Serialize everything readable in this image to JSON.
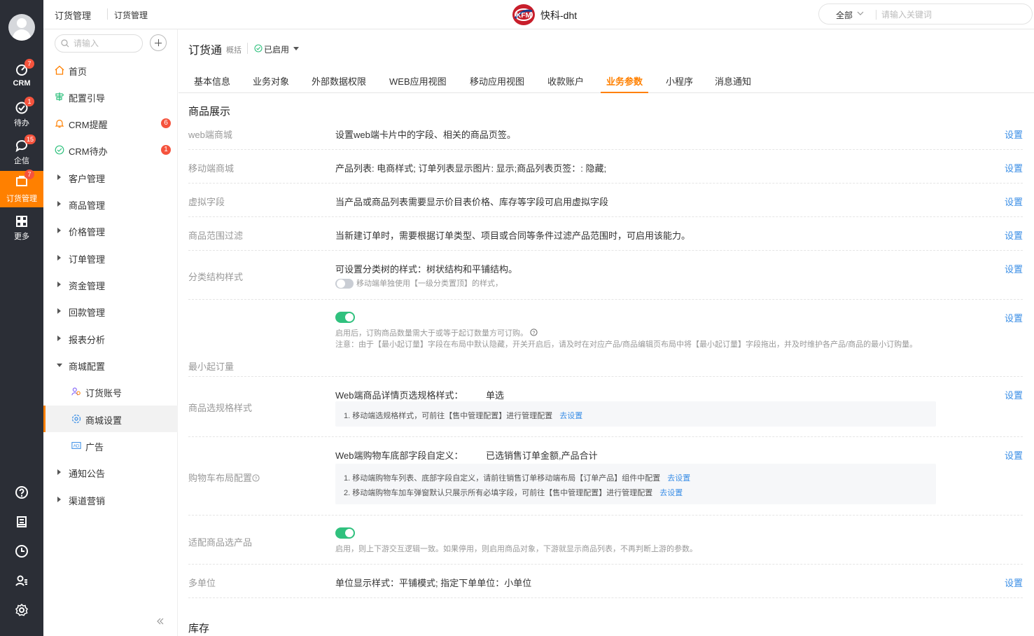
{
  "rail": {
    "items": [
      {
        "label": "CRM",
        "badge": "7",
        "icon": "crm-icon"
      },
      {
        "label": "待办",
        "badge": "1",
        "icon": "todo-check-icon"
      },
      {
        "label": "企信",
        "badge": "15",
        "icon": "chat-bubble-icon"
      },
      {
        "label": "订货管理",
        "badge": "7",
        "icon": "order-bag-icon"
      },
      {
        "label": "更多",
        "badge": "",
        "icon": "grid-icon"
      }
    ]
  },
  "topbar": {
    "crumb1": "订货管理",
    "crumb2": "订货管理",
    "brand": "快科-dht",
    "search_scope": "全部",
    "search_placeholder": "请输入关键词"
  },
  "sidebar": {
    "search_placeholder": "请输入",
    "items": [
      {
        "label": "首页",
        "badge": ""
      },
      {
        "label": "配置引导",
        "badge": ""
      },
      {
        "label": "CRM提醒",
        "badge": "6"
      },
      {
        "label": "CRM待办",
        "badge": "1"
      },
      {
        "label": "客户管理"
      },
      {
        "label": "商品管理"
      },
      {
        "label": "价格管理"
      },
      {
        "label": "订单管理"
      },
      {
        "label": "资金管理"
      },
      {
        "label": "回款管理"
      },
      {
        "label": "报表分析"
      },
      {
        "label": "商城配置"
      },
      {
        "label": "订货账号"
      },
      {
        "label": "商城设置"
      },
      {
        "label": "广告"
      },
      {
        "label": "通知公告"
      },
      {
        "label": "渠道营销"
      }
    ]
  },
  "main": {
    "title": "订货通",
    "subtitle": "概括",
    "status": "已启用",
    "tabs": [
      "基本信息",
      "业务对象",
      "外部数据权限",
      "WEB应用视图",
      "移动应用视图",
      "收款账户",
      "业务参数",
      "小程序",
      "消息通知"
    ],
    "active_tab": "业务参数",
    "section1": "商品展示",
    "section2": "库存",
    "set_label": "设置",
    "rows": {
      "web_mall": {
        "label": "web端商城",
        "content": "设置web端卡片中的字段、相关的商品页签。"
      },
      "mobile_mall": {
        "label": "移动端商城",
        "content": "产品列表: 电商样式; 订单列表显示图片: 显示;商品列表页签：: 隐藏;"
      },
      "virtual_field": {
        "label": "虚拟字段",
        "content": "当产品或商品列表需要显示价目表价格、库存等字段可启用虚拟字段"
      },
      "range_filter": {
        "label": "商品范围过滤",
        "content": "当新建订单时，需要根据订单类型、项目或合同等条件过滤产品范围时，可启用该能力。"
      },
      "category_style": {
        "label": "分类结构样式",
        "content": "可设置分类树的样式：树状结构和平铺结构。",
        "toggle_note": "移动端单独使用【一级分类置顶】的样式，"
      },
      "min_order": {
        "label": "最小起订量",
        "note1": "启用后，订购商品数量需大于或等于起订数量方可订购。",
        "note2": "注意：由于【最小起订量】字段在布局中默认隐藏，开关开启后，请及时在对应产品/商品编辑页布局中将【最小起订量】字段拖出，并及时维护各产品/商品的最小订购量。"
      },
      "spec_style": {
        "label": "商品选规格样式",
        "key": "Web端商品详情页选规格样式：",
        "value": "单选",
        "box1": "1. 移动端选规格样式，可前往【售中管理配置】进行管理配置",
        "link": "去设置"
      },
      "cart_layout": {
        "label": "购物车布局配置",
        "key": "Web端购物车底部字段自定义：",
        "value": "已选销售订单金额,产品合计",
        "box1": "1. 移动端购物车列表、底部字段自定义，请前往销售订单移动端布局【订单产品】组件中配置",
        "box2": "2. 移动端购物车加车弹窗默认只展示所有必填字段，可前往【售中管理配置】进行管理配置",
        "link": "去设置"
      },
      "adapt_product": {
        "label": "适配商品选产品",
        "note": "启用，则上下游交互逻辑一致。如果停用，则启用商品对象，下游就显示商品列表，不再判断上游的参数。"
      },
      "multi_unit": {
        "label": "多单位",
        "content": "单位显示样式：平铺模式; 指定下单单位：小单位"
      }
    }
  },
  "colors": {
    "accent": "#ff8000",
    "rail_bg": "#2b2e36",
    "link": "#3a8ee6",
    "toggle_on": "#30c17e",
    "badge": "#f5533d"
  }
}
